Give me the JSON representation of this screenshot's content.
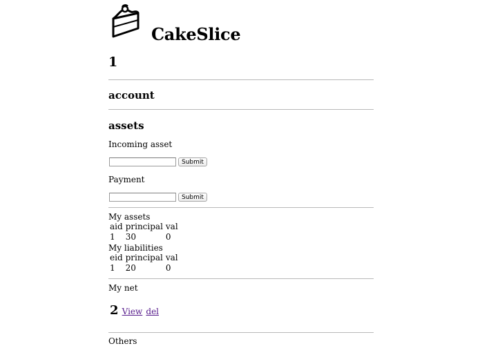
{
  "app": {
    "name": "CakeSlice",
    "logo_icon": "cake-slice-icon"
  },
  "record": {
    "id": "1"
  },
  "sections": {
    "account": "account",
    "assets": "assets"
  },
  "forms": {
    "incoming": {
      "label": "Incoming asset",
      "value": "",
      "submit": "Submit"
    },
    "payment": {
      "label": "Payment",
      "value": "",
      "submit": "Submit"
    }
  },
  "assets_table": {
    "title": "My assets",
    "headers": [
      "aid",
      "principal",
      "val"
    ],
    "rows": [
      [
        "1",
        "30",
        "0"
      ]
    ]
  },
  "liabilities_table": {
    "title": "My liabilities",
    "headers": [
      "eid",
      "principal",
      "val"
    ],
    "rows": [
      [
        "1",
        "20",
        "0"
      ]
    ]
  },
  "net": {
    "title": "My net",
    "id": "2",
    "view_link": "View",
    "del_link": "del"
  },
  "others": {
    "label": "Others"
  },
  "colors": {
    "link_visited": "#551a8b",
    "divider": "#b8b8b8"
  }
}
